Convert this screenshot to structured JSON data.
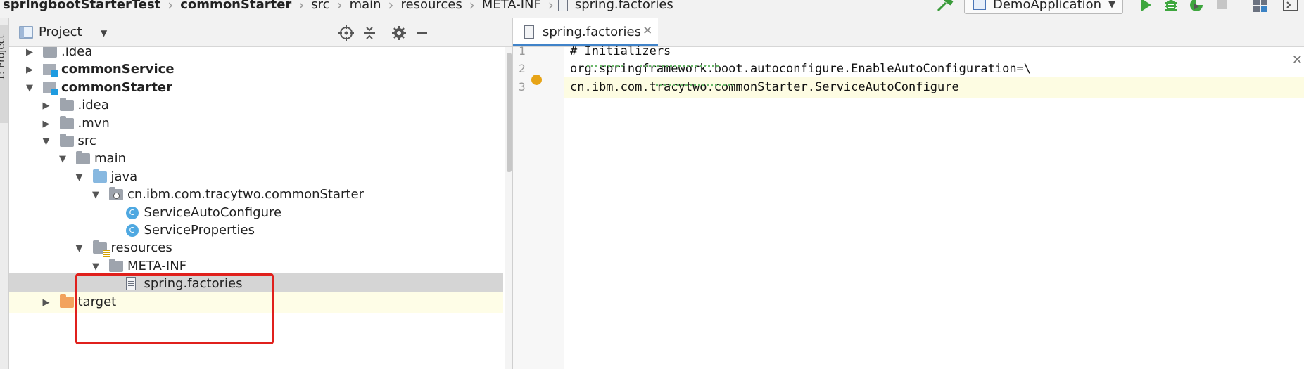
{
  "breadcrumb": [
    {
      "label": "springbootStarterTest",
      "bold": true
    },
    {
      "label": "commonStarter",
      "bold": true
    },
    {
      "label": "src",
      "bold": false
    },
    {
      "label": "main",
      "bold": false
    },
    {
      "label": "resources",
      "bold": false
    },
    {
      "label": "META-INF",
      "bold": false
    },
    {
      "label": "spring.factories",
      "bold": false
    }
  ],
  "toolbar": {
    "run_config": "DemoApplication",
    "icons": [
      "hammer-icon",
      "run-icon",
      "debug-icon",
      "coverage-icon",
      "stop-icon",
      "project-structure-icon",
      "terminal-icon"
    ]
  },
  "left_strip": {
    "tab_label": "1: Project"
  },
  "project_panel": {
    "title": "Project",
    "tree": [
      {
        "label": ".idea",
        "depth": 0,
        "icon": "folder",
        "arrow": "right",
        "bold": false
      },
      {
        "label": "commonService",
        "depth": 0,
        "icon": "module",
        "arrow": "right",
        "bold": true
      },
      {
        "label": "commonStarter",
        "depth": 0,
        "icon": "module",
        "arrow": "down",
        "bold": true
      },
      {
        "label": ".idea",
        "depth": 1,
        "icon": "folder",
        "arrow": "right",
        "bold": false
      },
      {
        "label": ".mvn",
        "depth": 1,
        "icon": "folder",
        "arrow": "right",
        "bold": false
      },
      {
        "label": "src",
        "depth": 1,
        "icon": "folder",
        "arrow": "down",
        "bold": false
      },
      {
        "label": "main",
        "depth": 2,
        "icon": "folder",
        "arrow": "down",
        "bold": false
      },
      {
        "label": "java",
        "depth": 3,
        "icon": "source-folder",
        "arrow": "down",
        "bold": false
      },
      {
        "label": "cn.ibm.com.tracytwo.commonStarter",
        "depth": 4,
        "icon": "package",
        "arrow": "down",
        "bold": false
      },
      {
        "label": "ServiceAutoConfigure",
        "depth": 5,
        "icon": "class",
        "arrow": "",
        "bold": false
      },
      {
        "label": "ServiceProperties",
        "depth": 5,
        "icon": "class",
        "arrow": "",
        "bold": false
      },
      {
        "label": "resources",
        "depth": 3,
        "icon": "resources-folder",
        "arrow": "down",
        "bold": false
      },
      {
        "label": "META-INF",
        "depth": 4,
        "icon": "folder",
        "arrow": "down",
        "bold": false
      },
      {
        "label": "spring.factories",
        "depth": 5,
        "icon": "file",
        "arrow": "",
        "bold": false,
        "selected": true
      },
      {
        "label": "target",
        "depth": 1,
        "icon": "excluded-folder",
        "arrow": "right",
        "bold": false,
        "highlight": true
      }
    ]
  },
  "editor": {
    "tab_label": "spring.factories",
    "lines": [
      {
        "num": "1",
        "text": "# Initializers"
      },
      {
        "num": "2",
        "text": "org.springframework.boot.autoconfigure.EnableAutoConfiguration=\\"
      },
      {
        "num": "3",
        "text": "cn.ibm.com.tracytwo.commonStarter.ServiceAutoConfigure"
      }
    ],
    "current_line": "3"
  }
}
